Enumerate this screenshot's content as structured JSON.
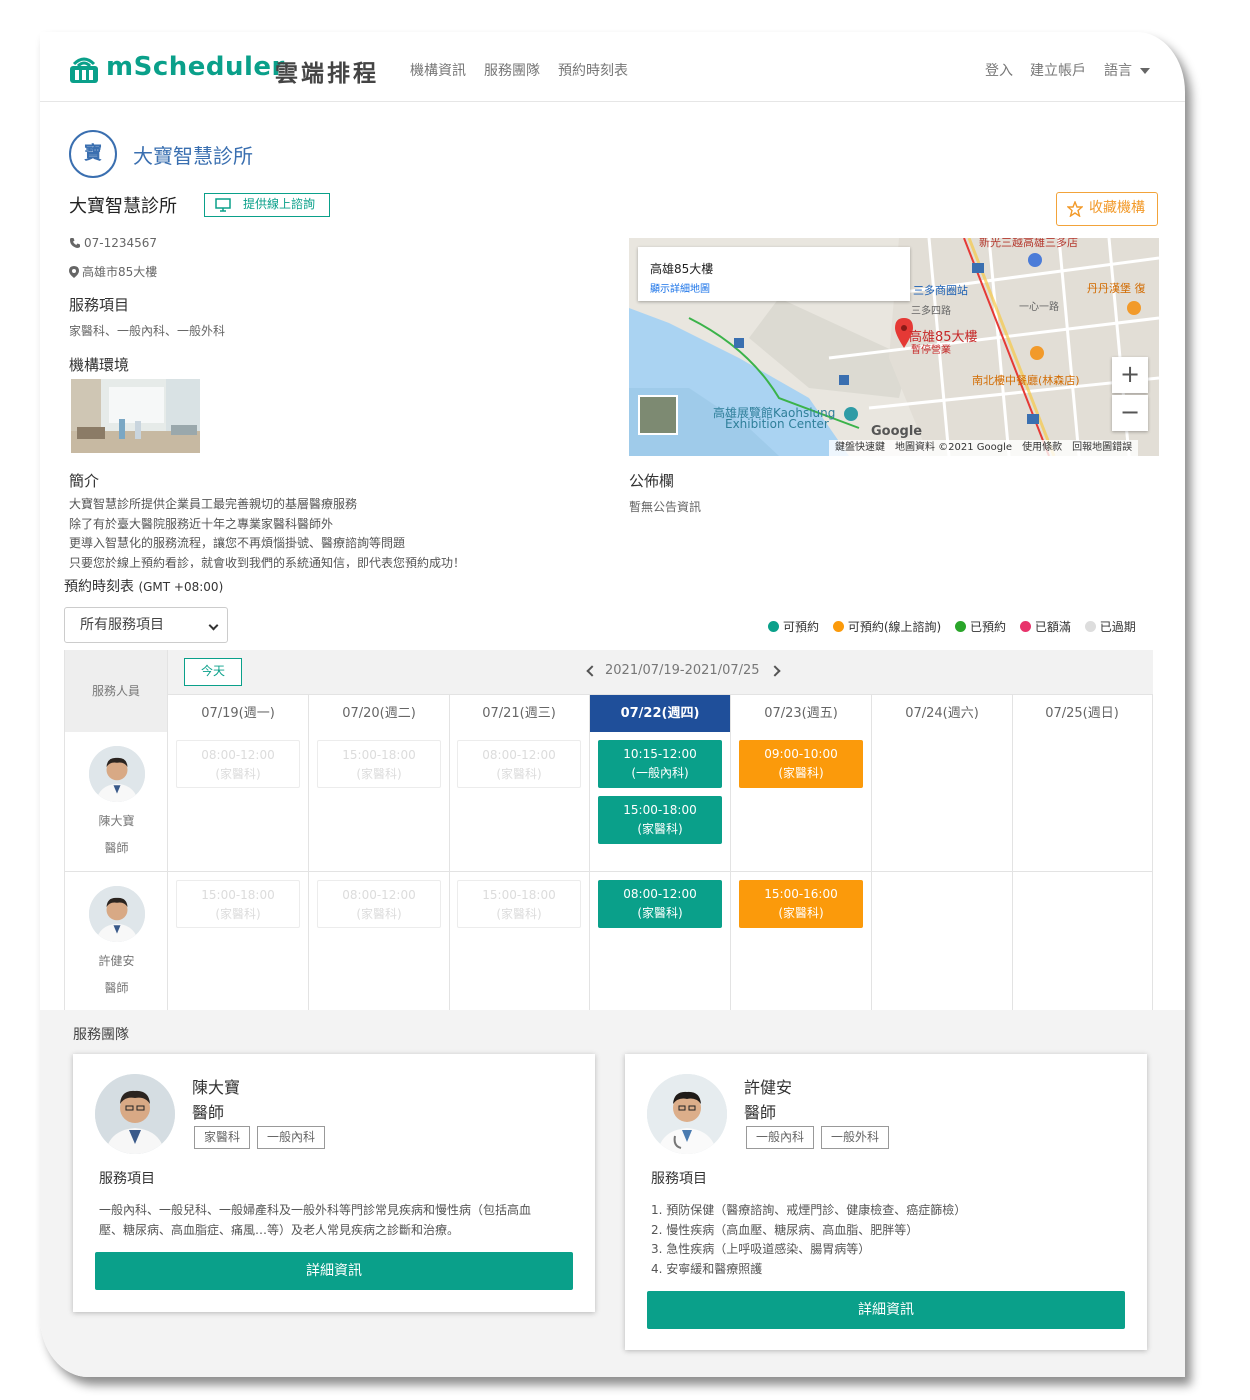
{
  "nav": {
    "brand": "mScheduler",
    "brand_cn": "雲端排程",
    "links": [
      "機構資訊",
      "服務團隊",
      "預約時刻表"
    ],
    "login": "登入",
    "signup": "建立帳戶",
    "language": "語言"
  },
  "clinic": {
    "avatar_char": "寶",
    "title": "大寶智慧診所",
    "name": "大寶智慧診所",
    "online_badge": "提供線上諮詢",
    "favorite_btn": "收藏機構",
    "phone": "07-1234567",
    "address": "高雄市85大樓",
    "services_heading": "服務項目",
    "services": "家醫科、一般內科、一般外科",
    "environment_heading": "機構環境",
    "intro_heading": "簡介",
    "intro_lines": [
      "大寶智慧診所提供企業員工最完善親切的基層醫療服務",
      "除了有於臺大醫院服務近十年之專業家醫科醫師外",
      "更導入智慧化的服務流程，讓您不再煩惱掛號、醫療諮詢等問題",
      "只要您於線上預約看診，就會收到我們的系統通知信，即代表您預約成功！"
    ],
    "bulletin_heading": "公佈欄",
    "bulletin_text": "暫無公告資訊"
  },
  "map": {
    "card_title": "高雄85大樓",
    "card_link": "顯示詳細地圖",
    "zoom_in": "+",
    "zoom_out": "−",
    "footer": "鍵盤快速鍵　地圖資料 ©2021 Google　使用條款　回報地圖錯誤",
    "labels": {
      "main": "高雄85大樓",
      "main_sub": "暫停營業",
      "station": "三多商圈站",
      "road1": "三多四路",
      "road2": "一心一路",
      "restaurant": "南北樓中餐廳(林森店)",
      "exhibition1": "高雄展覽館Kaohsiung",
      "exhibition2": "Exhibition Center",
      "burger": "丹丹漢堡 復",
      "google": "Google",
      "top_road": "新光三越高雄三多店"
    }
  },
  "schedule": {
    "heading": "預約時刻表",
    "timezone": "(GMT +08:00)",
    "filter_value": "所有服務項目",
    "legend": [
      {
        "label": "可預約",
        "color": "#0aa08a"
      },
      {
        "label": "可預約(線上諮詢)",
        "color": "#fb9a0b"
      },
      {
        "label": "已預約",
        "color": "#2aa52a"
      },
      {
        "label": "已額滿",
        "color": "#e8336b"
      },
      {
        "label": "已過期",
        "color": "#dddddd"
      }
    ],
    "staff_col": "服務人員",
    "today_btn": "今天",
    "week_range": "2021/07/19-2021/07/25",
    "days": [
      "07/19(週一)",
      "07/20(週二)",
      "07/21(週三)",
      "07/22(週四)",
      "07/23(週五)",
      "07/24(週六)",
      "07/25(週日)"
    ],
    "active_day": 3,
    "staff": [
      {
        "name": "陳大寶",
        "title": "醫師",
        "slots": [
          {
            "day": 0,
            "time": "08:00-12:00",
            "dept": "(家醫科)",
            "status": "past"
          },
          {
            "day": 1,
            "time": "15:00-18:00",
            "dept": "(家醫科)",
            "status": "past"
          },
          {
            "day": 2,
            "time": "08:00-12:00",
            "dept": "(家醫科)",
            "status": "past"
          },
          {
            "day": 3,
            "time": "10:15-12:00",
            "dept": "(一般內科)",
            "status": "green"
          },
          {
            "day": 3,
            "time": "15:00-18:00",
            "dept": "(家醫科)",
            "status": "green",
            "row": 1
          },
          {
            "day": 4,
            "time": "09:00-10:00",
            "dept": "(家醫科)",
            "status": "orange"
          }
        ]
      },
      {
        "name": "許健安",
        "title": "醫師",
        "slots": [
          {
            "day": 0,
            "time": "15:00-18:00",
            "dept": "(家醫科)",
            "status": "past"
          },
          {
            "day": 1,
            "time": "08:00-12:00",
            "dept": "(家醫科)",
            "status": "past"
          },
          {
            "day": 2,
            "time": "15:00-18:00",
            "dept": "(家醫科)",
            "status": "past"
          },
          {
            "day": 3,
            "time": "08:00-12:00",
            "dept": "(家醫科)",
            "status": "green"
          },
          {
            "day": 4,
            "time": "15:00-16:00",
            "dept": "(家醫科)",
            "status": "orange"
          }
        ]
      }
    ]
  },
  "team": {
    "heading": "服務團隊",
    "members": [
      {
        "name": "陳大寶",
        "title": "醫師",
        "tags": [
          "家醫科",
          "一般內科"
        ],
        "services_heading": "服務項目",
        "services_lines": [
          "一般內科、一般兒科、一般婦產科及一般外科等門診常見疾病和慢性病（包括高血",
          "壓、糖尿病、高血脂症、痛風…等）及老人常見疾病之診斷和治療。"
        ],
        "detail_btn": "詳細資訊"
      },
      {
        "name": "許健安",
        "title": "醫師",
        "tags": [
          "一般內科",
          "一般外科"
        ],
        "services_heading": "服務項目",
        "services_lines": [
          "1. 預防保健（醫療諮詢、戒煙門診、健康檢查、癌症篩檢）",
          "2. 慢性疾病（高血壓、糖尿病、高血脂、肥胖等）",
          "3. 急性疾病（上呼吸道感染、腸胃病等）",
          "4. 安寧緩和醫療照護"
        ],
        "detail_btn": "詳細資訊"
      }
    ]
  }
}
